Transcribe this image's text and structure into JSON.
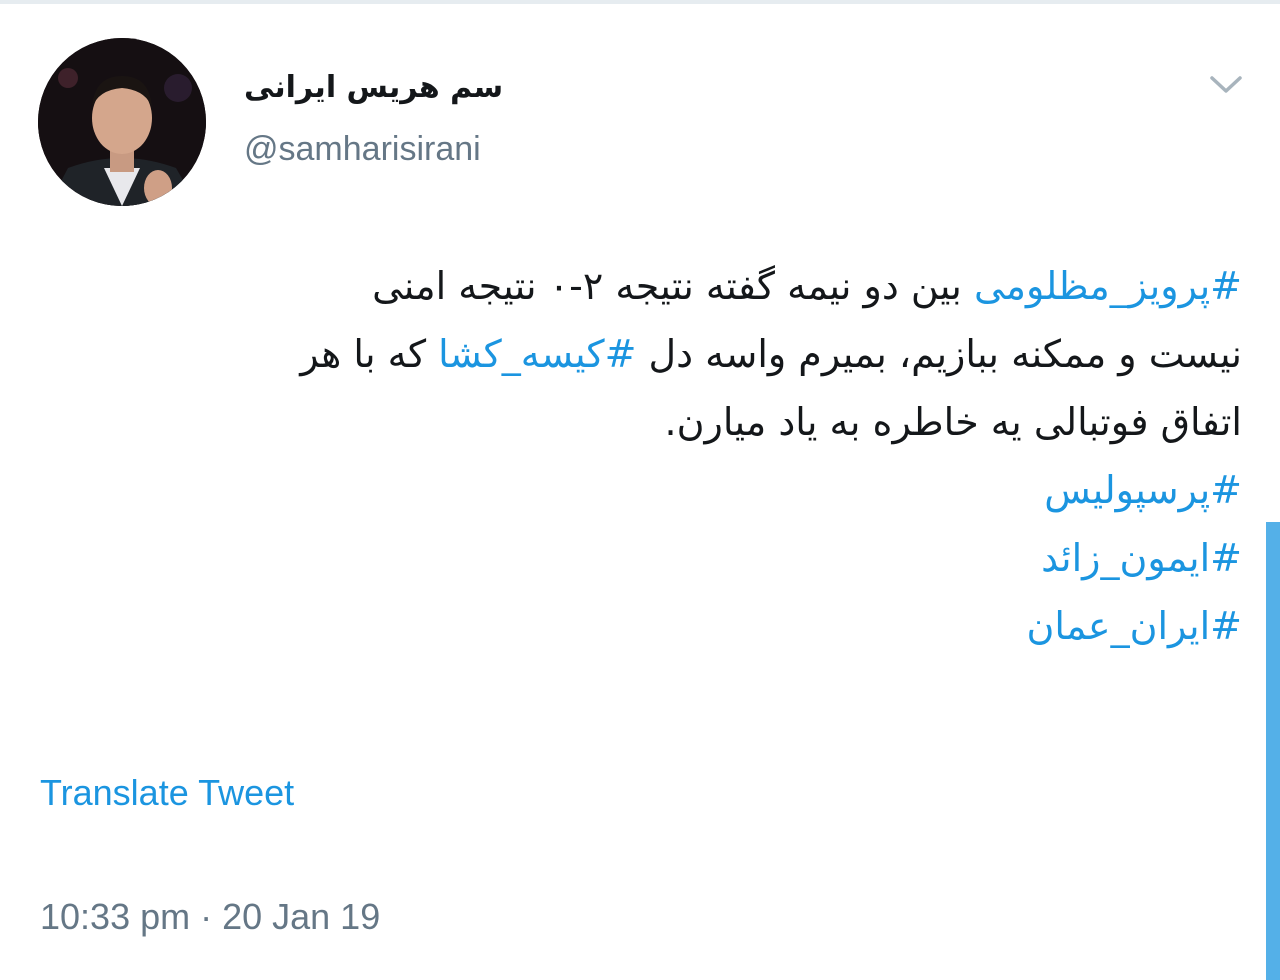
{
  "tweet": {
    "display_name": "سم هریس ایرانی",
    "handle": "@samharisirani",
    "body": {
      "lines": [
        [
          {
            "text": "#پرویز_مظلومی",
            "hashtag": true
          },
          {
            "text": " بین دو نیمه گفته نتیجه ۲-۰ نتیجه امنی",
            "hashtag": false
          }
        ],
        [
          {
            "text": "نیست و ممکنه ببازیم، بمیرم واسه دل ",
            "hashtag": false
          },
          {
            "text": "#کیسه_کشا",
            "hashtag": true
          },
          {
            "text": " که با هر",
            "hashtag": false
          }
        ],
        [
          {
            "text": "اتفاق فوتبالی یه خاطره به یاد میارن.",
            "hashtag": false
          }
        ]
      ],
      "hashtags": [
        "#پرسپولیس",
        "#ایمون_زائد",
        "#ایران_عمان"
      ]
    },
    "translate_label": "Translate Tweet",
    "timestamp": "10:33 pm · 20 Jan 19"
  },
  "icons": {
    "caret": "chevron-down-icon",
    "avatar": "avatar-photo"
  },
  "colors": {
    "link": "#1b95e0",
    "text": "#14171a",
    "secondary": "#657786"
  }
}
